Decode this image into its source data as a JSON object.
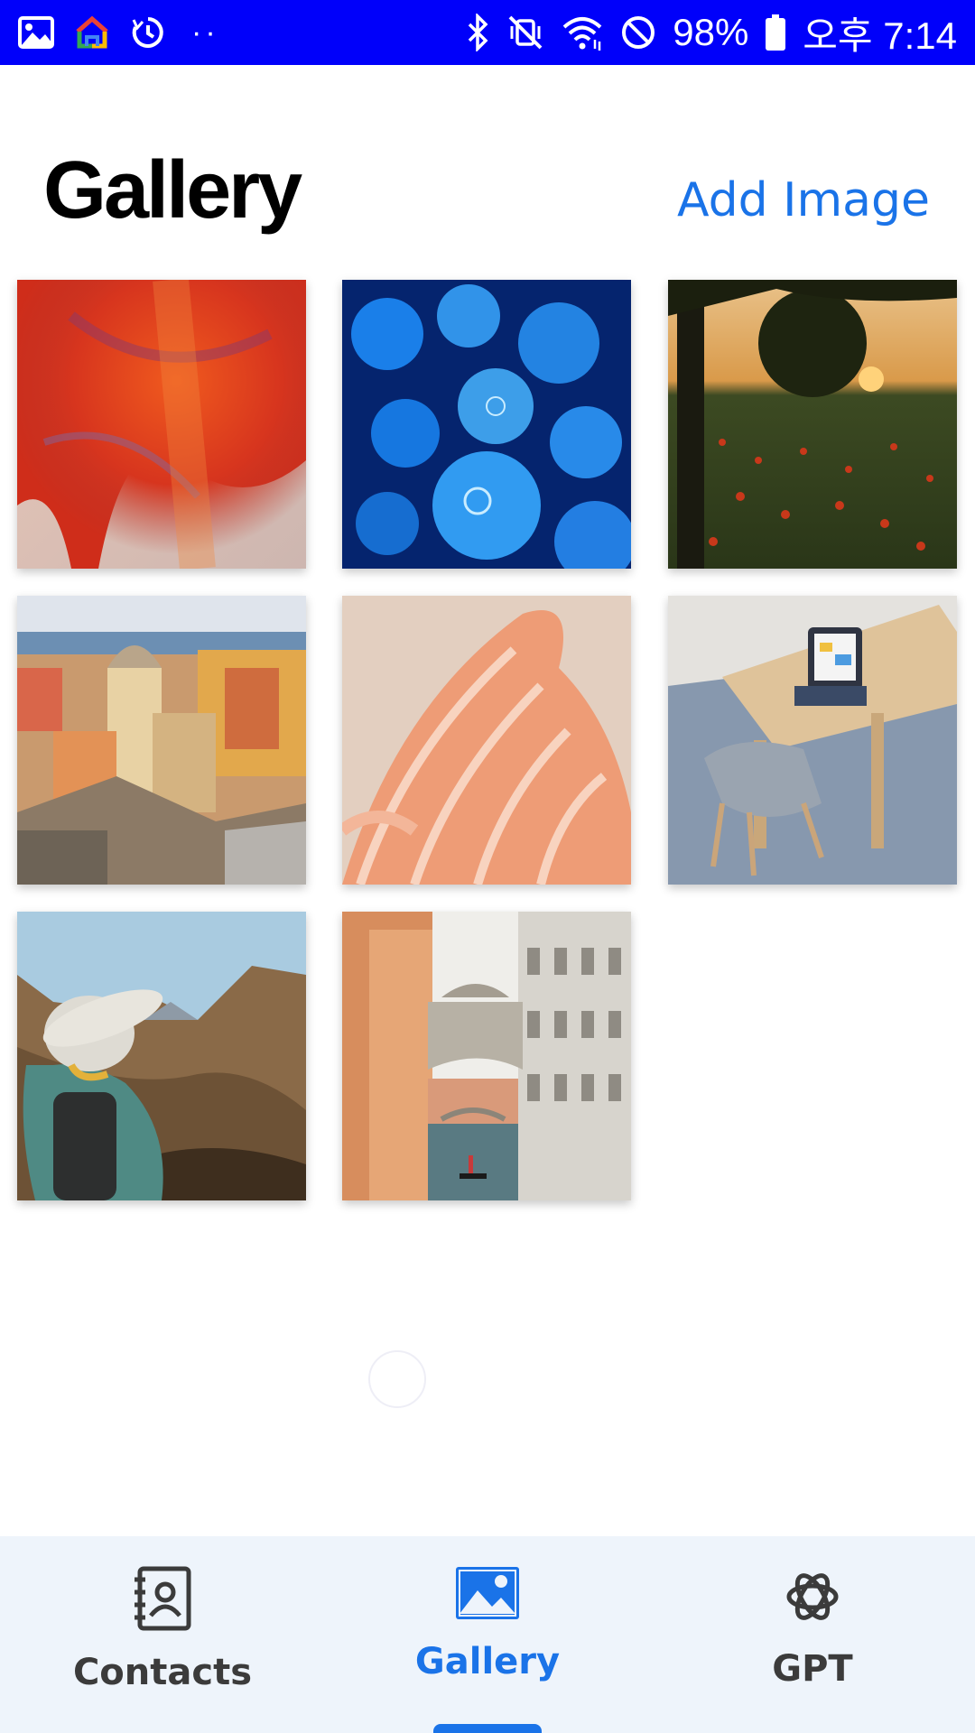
{
  "status_bar": {
    "left_icons": [
      "image-icon",
      "google-home-icon",
      "timer-icon"
    ],
    "more_indicator": "··",
    "right_icons": [
      "bluetooth-icon",
      "vibrate-mute-icon",
      "wifi-icon",
      "do-not-disturb-icon"
    ],
    "battery_percent": "98%",
    "battery_icon": "battery-icon",
    "time": "오후 7:14",
    "background_color": "#0000fa"
  },
  "header": {
    "title": "Gallery",
    "add_button_label": "Add Image",
    "accent_color": "#1a73e8"
  },
  "gallery": {
    "images": [
      {
        "subject": "red-abstract-texture"
      },
      {
        "subject": "blue-jellyfish"
      },
      {
        "subject": "sunset-field-tree"
      },
      {
        "subject": "coastal-town-bell-tower"
      },
      {
        "subject": "peach-wave-sculpture"
      },
      {
        "subject": "table-with-tablet-and-chairs"
      },
      {
        "subject": "hiker-in-mountains"
      },
      {
        "subject": "venice-bridge-canal"
      }
    ]
  },
  "bottom_nav": {
    "items": [
      {
        "label": "Contacts",
        "icon": "contacts-icon",
        "active": false
      },
      {
        "label": "Gallery",
        "icon": "image-icon",
        "active": true
      },
      {
        "label": "GPT",
        "icon": "openai-icon",
        "active": false
      }
    ],
    "background_color": "#eef4fb",
    "active_color": "#1a73e8"
  }
}
